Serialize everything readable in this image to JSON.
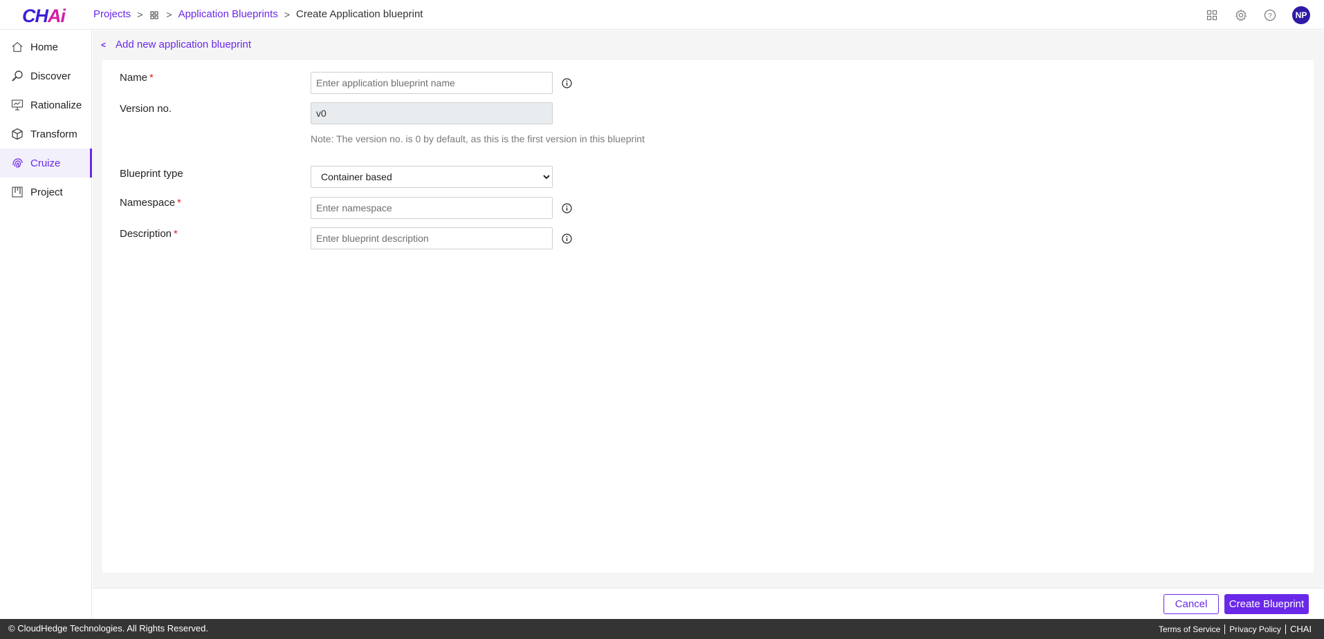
{
  "app": {
    "logo_text": "CHAi",
    "avatar_initials": "NP"
  },
  "breadcrumb": {
    "projects": "Projects",
    "application_blueprints": "Application Blueprints",
    "current": "Create Application blueprint"
  },
  "sidebar": {
    "items": [
      {
        "label": "Home",
        "icon": "home-icon"
      },
      {
        "label": "Discover",
        "icon": "discover-icon"
      },
      {
        "label": "Rationalize",
        "icon": "rationalize-icon"
      },
      {
        "label": "Transform",
        "icon": "cube-icon"
      },
      {
        "label": "Cruize",
        "icon": "fingerprint-icon",
        "active": true
      },
      {
        "label": "Project",
        "icon": "kanban-icon"
      }
    ]
  },
  "page": {
    "back_label": "Add new application blueprint"
  },
  "form": {
    "name": {
      "label": "Name",
      "placeholder": "Enter application blueprint name",
      "value": ""
    },
    "version": {
      "label": "Version no.",
      "value": "v0",
      "note": "Note: The version no. is 0 by default, as this is the first version in this blueprint"
    },
    "blueprint_type": {
      "label": "Blueprint type",
      "selected": "Container based"
    },
    "namespace": {
      "label": "Namespace",
      "placeholder": "Enter namespace",
      "value": ""
    },
    "description": {
      "label": "Description",
      "placeholder": "Enter blueprint description",
      "value": ""
    },
    "required_marker": "*"
  },
  "actions": {
    "cancel": "Cancel",
    "create": "Create Blueprint"
  },
  "footer": {
    "copyright": "© CloudHedge Technologies. All Rights Reserved.",
    "terms": "Terms of Service",
    "privacy": "Privacy Policy",
    "brand": "CHAI"
  },
  "colors": {
    "accent": "#6a28e8",
    "required": "#e02020",
    "footer_bg": "#343434",
    "avatar_bg": "#2f1aa6"
  }
}
